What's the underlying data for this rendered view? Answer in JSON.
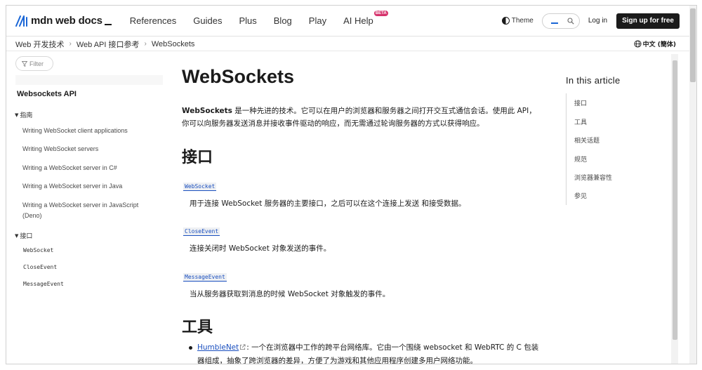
{
  "header": {
    "logo_text": "mdn web docs",
    "nav": [
      {
        "label": "References"
      },
      {
        "label": "Guides"
      },
      {
        "label": "Plus"
      },
      {
        "label": "Blog"
      },
      {
        "label": "Play"
      },
      {
        "label": "AI Help",
        "badge": "BETA"
      }
    ],
    "theme_label": "Theme",
    "login_label": "Log in",
    "signup_label": "Sign up for free",
    "accent_color": "#1a66d6"
  },
  "breadcrumb": {
    "items": [
      "Web 开发技术",
      "Web API 接口参考",
      "WebSockets"
    ],
    "language": "中文 (簡体)"
  },
  "sidebar": {
    "filter_placeholder": "Filter",
    "title": "Websockets API",
    "group_guides": "指南",
    "guides": [
      "Writing WebSocket client applications",
      "Writing WebSocket servers",
      "Writing a WebSocket server in C#",
      "Writing a WebSocket server in Java",
      "Writing a WebSocket server in JavaScript (Deno)"
    ],
    "group_interfaces": "接口",
    "interfaces": [
      "WebSocket",
      "CloseEvent",
      "MessageEvent"
    ]
  },
  "main": {
    "title": "WebSockets",
    "intro_strong": "WebSockets",
    "intro_rest": " 是一种先进的技术。它可以在用户的浏览器和服务器之间打开交互式通信会话。使用此 API，你可以向服务器发送消息并接收事件驱动的响应，而无需通过轮询服务器的方式以获得响应。",
    "h2_interfaces": "接口",
    "terms": [
      {
        "name": "WebSocket",
        "desc": "用于连接 WebSocket 服务器的主要接口，之后可以在这个连接上发送 和接受数据。"
      },
      {
        "name": "CloseEvent",
        "desc": "连接关闭时 WebSocket 对象发送的事件。"
      },
      {
        "name": "MessageEvent",
        "desc": "当从服务器获取到消息的时候 WebSocket 对象触发的事件。"
      }
    ],
    "h2_tools": "工具",
    "tool": {
      "link": "HumbleNet",
      "text": ": 一个在浏览器中工作的跨平台网络库。它由一个围绕 websocket 和 WebRTC 的 C 包装器组成，抽象了跨浏览器的差异，方便了为游戏和其他应用程序创建多用户网络功能。"
    }
  },
  "toc": {
    "title": "In this article",
    "items": [
      "接口",
      "工具",
      "相关话题",
      "规范",
      "浏览器兼容性",
      "参见"
    ]
  }
}
